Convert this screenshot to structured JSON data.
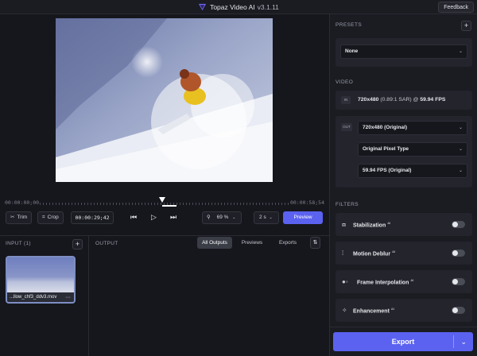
{
  "app": {
    "title": "Topaz Video AI",
    "version": "v3.1.11",
    "feedback_label": "Feedback"
  },
  "timeline": {
    "start_time": "00:00:00;00",
    "end_time": "00:00:58;54"
  },
  "controls": {
    "trim_label": "Trim",
    "crop_label": "Crop",
    "timecode": "00:00:29;42",
    "zoom_value": "69",
    "zoom_unit": "%",
    "seconds_value": "2",
    "seconds_unit": "s",
    "preview_label": "Preview"
  },
  "input_panel": {
    "label": "INPUT (1)",
    "file_name": "...llow_chf3_ddv3.mov"
  },
  "output_panel": {
    "label": "OUTPUT",
    "tabs": [
      "All Outputs",
      "Previews",
      "Exports"
    ],
    "active_tab": "All Outputs"
  },
  "sidebar": {
    "presets_label": "PRESETS",
    "preset_value": "None",
    "video_label": "VIDEO",
    "in_tag": "IN",
    "out_tag": "OUT",
    "input_res": "720x480",
    "input_sar": "(0.89:1 SAR) @",
    "input_fps": "59.94 FPS",
    "output_resolution": "720x480 (Original)",
    "output_pixel_type": "Original Pixel Type",
    "output_fps": "59.94 FPS (Original)",
    "filters_label": "FILTERS",
    "filters": [
      {
        "label": "Stabilization",
        "ai": "AI",
        "icon": "stabilization-icon",
        "enabled": false
      },
      {
        "label": "Motion Deblur",
        "ai": "AI",
        "icon": "motion-deblur-icon",
        "enabled": false
      },
      {
        "label": "Frame Interpolation",
        "ai": "AI",
        "icon": "frame-interpolation-icon",
        "enabled": false
      },
      {
        "label": "Enhancement",
        "ai": "AI",
        "icon": "enhancement-icon",
        "enabled": false
      }
    ],
    "export_label": "Export"
  },
  "colors": {
    "accent": "#5b62f0",
    "background": "#16171d",
    "panel": "#1b1c22",
    "card": "#23242c"
  }
}
